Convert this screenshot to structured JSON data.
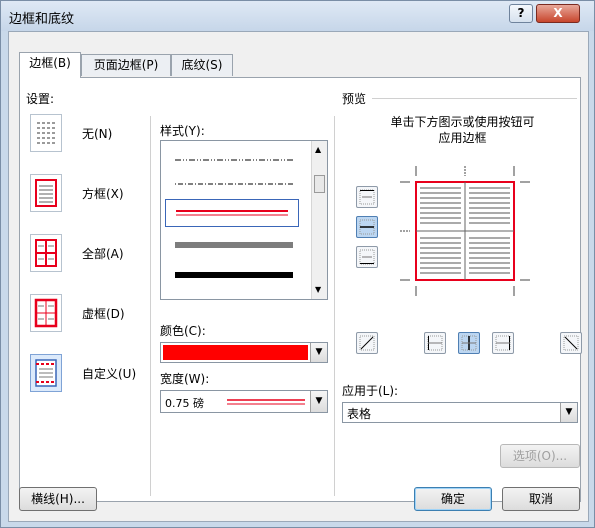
{
  "window": {
    "title": "边框和底纹",
    "help": "?",
    "close": "X"
  },
  "tabs": [
    {
      "label": "边框(B)"
    },
    {
      "label": "页面边框(P)"
    },
    {
      "label": "底纹(S)"
    }
  ],
  "settings": {
    "title": "设置:",
    "items": [
      {
        "label": "无(N)"
      },
      {
        "label": "方框(X)"
      },
      {
        "label": "全部(A)"
      },
      {
        "label": "虚框(D)"
      },
      {
        "label": "自定义(U)"
      }
    ],
    "selected": "自定义(U)"
  },
  "style": {
    "title": "样式(Y):",
    "lines": [
      "dash-dot-dot",
      "dot-dash",
      "double-red-selected",
      "thick-gray",
      "thick-black"
    ],
    "selected_color": "#ff0000"
  },
  "color": {
    "title": "颜色(C):",
    "value": "#ff0000"
  },
  "width": {
    "title": "宽度(W):",
    "value": "0.75 磅"
  },
  "preview": {
    "title": "预览",
    "hint_line1": "单击下方图示或使用按钮可",
    "hint_line2": "应用边框"
  },
  "apply_to": {
    "title": "应用于(L):",
    "value": "表格"
  },
  "buttons": {
    "options": "选项(O)...",
    "horizontal_line": "横线(H)...",
    "ok": "确定",
    "cancel": "取消"
  },
  "colors": {
    "border_red": "#e8001c",
    "accent_blue": "#3c7fb1"
  }
}
